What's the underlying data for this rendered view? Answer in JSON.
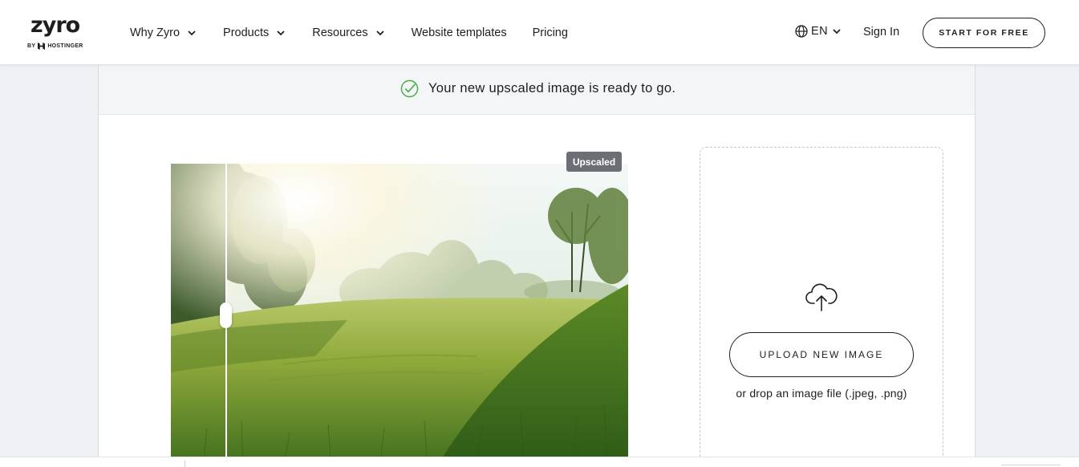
{
  "header": {
    "logo_text": "zyro",
    "logo_by": "BY",
    "logo_brand": "HOSTINGER",
    "nav": [
      {
        "label": "Why Zyro",
        "has_dropdown": true
      },
      {
        "label": "Products",
        "has_dropdown": true
      },
      {
        "label": "Resources",
        "has_dropdown": true
      },
      {
        "label": "Website templates",
        "has_dropdown": false
      },
      {
        "label": "Pricing",
        "has_dropdown": false
      }
    ],
    "language": "EN",
    "sign_in": "Sign In",
    "cta": "START FOR FREE"
  },
  "banner": {
    "message": "Your new upscaled image is ready to go.",
    "icon": "check-circle-icon",
    "icon_color": "#4caf50"
  },
  "preview": {
    "tag": "Upscaled",
    "image_description": "sunlit green meadow with trees",
    "comparison_position": 0.12
  },
  "upload": {
    "icon": "cloud-upload-icon",
    "button": "UPLOAD NEW IMAGE",
    "hint": "or drop an image file (.jpeg, .png)"
  },
  "colors": {
    "text": "#1d1e20",
    "page_bg": "#eef0f3",
    "banner_bg": "#f4f5f7",
    "tag_bg": "#6b6e75"
  }
}
